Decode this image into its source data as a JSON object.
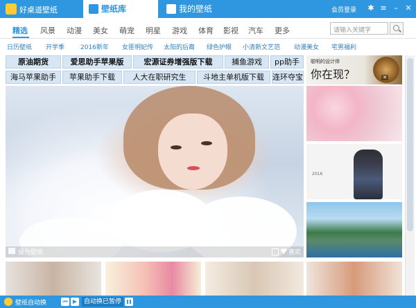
{
  "app": {
    "name": "好桌道壁纸"
  },
  "tabs": [
    {
      "label": "壁纸库"
    },
    {
      "label": "我的壁纸"
    }
  ],
  "header": {
    "login": "会员登录"
  },
  "nav": {
    "items": [
      "精选",
      "风景",
      "动漫",
      "美女",
      "萌宠",
      "明星",
      "游戏",
      "体育",
      "影视",
      "汽车",
      "更多"
    ],
    "active": "精选",
    "search_placeholder": "请输入关键字"
  },
  "subtags": [
    "日历壁纸",
    "开学季",
    "2016新年",
    "女匪明妃传",
    "太阳的后裔",
    "绿色护眼",
    "小清新文艺范",
    "动漫美女",
    "宅男福利"
  ],
  "ads": {
    "row1": [
      "原油期货",
      "爱思助手苹果版",
      "宏源证券增强版下载",
      "捕鱼游戏",
      "pp助手"
    ],
    "row2": [
      "海马苹果助手",
      "苹果助手下载",
      "人大在职研究生",
      "斗地主单机版下载",
      "连环夺宝"
    ]
  },
  "main_image": {
    "set_wallpaper": "设为壁纸",
    "like": "喜欢"
  },
  "side_ad": {
    "line1": "聪明的设计师",
    "line2": "你在现？"
  },
  "calendar": {
    "year": "2016"
  },
  "status": {
    "label": "壁纸自动换",
    "switch_label": "自动换已暂停"
  },
  "colors": {
    "accent": "#2f97e0",
    "ad_bg": "#d7e6f4"
  }
}
